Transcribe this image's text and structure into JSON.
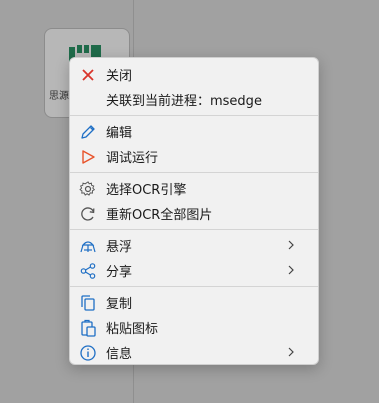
{
  "desktop": {
    "app_label": "思源"
  },
  "menu": {
    "items": [
      {
        "label": "关闭",
        "icon": "close-icon"
      },
      {
        "label": "关联到当前进程：msedge",
        "icon": ""
      },
      {
        "label": "编辑",
        "icon": "pencil-icon"
      },
      {
        "label": "调试运行",
        "icon": "play-icon"
      },
      {
        "label": "选择OCR引擎",
        "icon": "gear-icon"
      },
      {
        "label": "重新OCR全部图片",
        "icon": "refresh-icon"
      },
      {
        "label": "悬浮",
        "icon": "float-icon"
      },
      {
        "label": "分享",
        "icon": "share-icon"
      },
      {
        "label": "复制",
        "icon": "copy-icon"
      },
      {
        "label": "粘贴图标",
        "icon": "paste-icon"
      },
      {
        "label": "信息",
        "icon": "info-icon"
      }
    ]
  },
  "colors": {
    "close": "#d9342b",
    "accent": "#1f6fc5",
    "play": "#e8532a",
    "app_green": "#1f6b4a"
  }
}
